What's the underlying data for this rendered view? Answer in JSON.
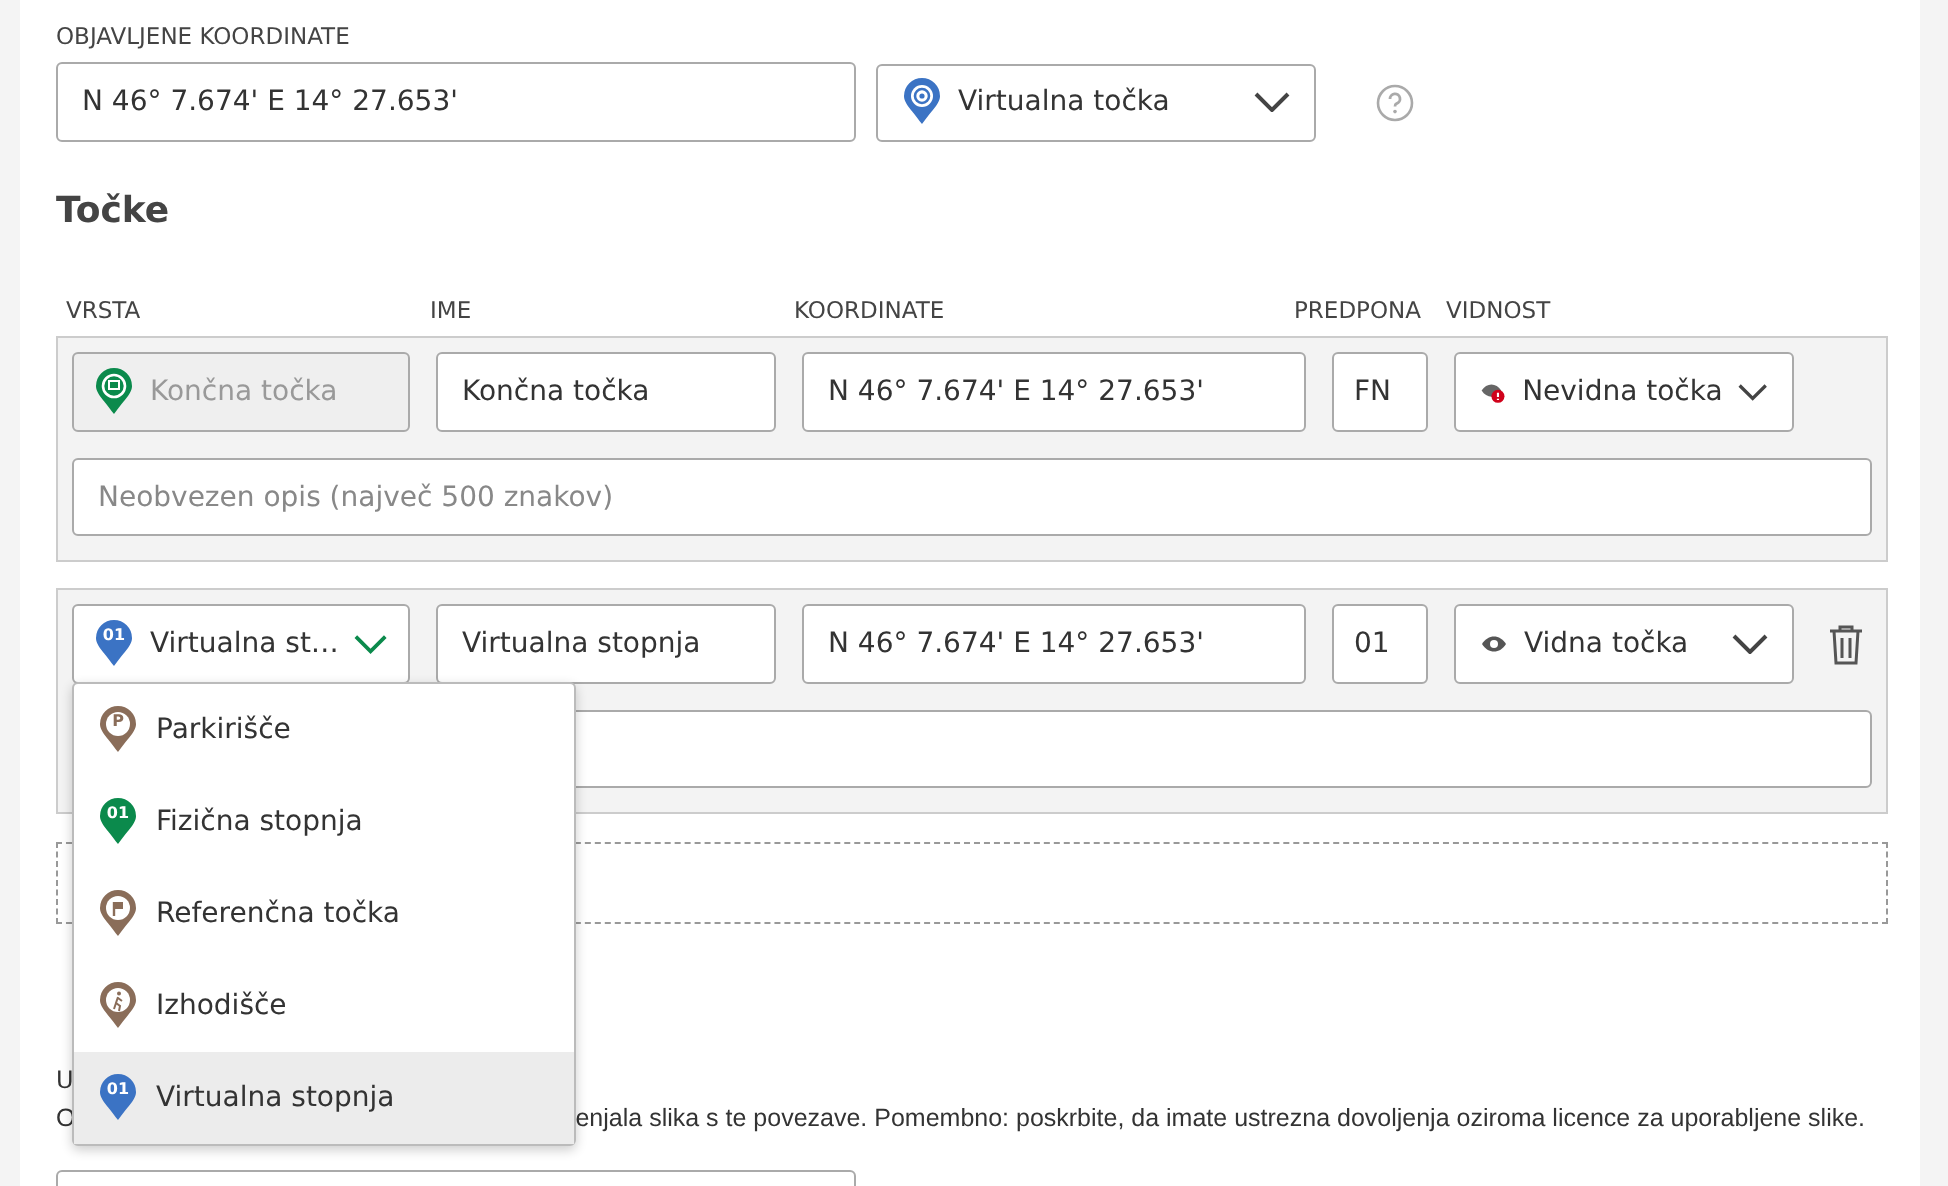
{
  "published": {
    "label": "OBJAVLJENE KOORDINATE",
    "coordinates": "N 46° 7.674' E 14° 27.653'",
    "type": "Virtualna točka",
    "kind": "virtual-point"
  },
  "points": {
    "title": "Točke",
    "columns": [
      "VRSTA",
      "IME",
      "KOORDINATE",
      "PREDPONA",
      "VIDNOST"
    ],
    "rows": [
      {
        "type": "Končna točka",
        "kind": "final",
        "type_disabled": true,
        "type_expanded": false,
        "name": "Končna točka",
        "coordinates": "N 46° 7.674' E 14° 27.653'",
        "prefix": "FN",
        "visibility": "Nevidna točka",
        "visible": false,
        "description_placeholder": "Neobvezen opis (največ 500 znakov)",
        "deletable": false
      },
      {
        "type": "Virtualna st…",
        "kind": "virtual-stage",
        "type_badge": "01",
        "type_disabled": false,
        "type_expanded": true,
        "name": "Virtualna stopnja",
        "coordinates": "N 46° 7.674' E 14° 27.653'",
        "prefix": "01",
        "visibility": "Vidna točka",
        "visible": true,
        "deletable": true
      }
    ]
  },
  "type_menu": [
    {
      "label": "Parkirišče",
      "kind": "parking",
      "badge": "P",
      "selected": false
    },
    {
      "label": "Fizična stopnja",
      "kind": "physical-stage",
      "badge": "01",
      "selected": false
    },
    {
      "label": "Referenčna točka",
      "kind": "reference",
      "selected": false
    },
    {
      "label": "Izhodišče",
      "kind": "start",
      "selected": false
    },
    {
      "label": "Virtualna stopnja",
      "kind": "virtual-stage",
      "badge": "01",
      "selected": true
    }
  ],
  "image_section": {
    "label_fragment": "U",
    "hint_fragments": [
      "O",
      "enjala slika s te povezave. Pomembno: poskrbite, da imate ustrezna dovoljenja oziroma licence za uporabljene slike."
    ]
  }
}
